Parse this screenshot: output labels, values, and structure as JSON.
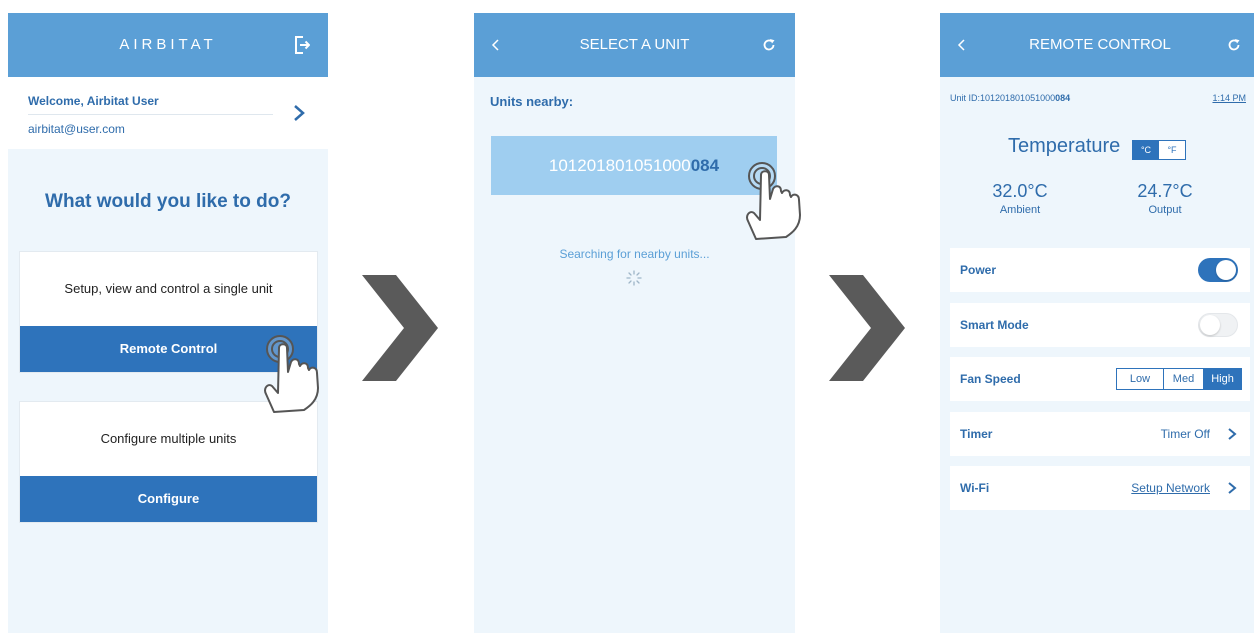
{
  "screen1": {
    "header_title": "AIRBITAT",
    "welcome": "Welcome, Airbitat User",
    "email": "airbitat@user.com",
    "question": "What would you like to do?",
    "card1_text": "Setup, view and control a single unit",
    "card1_button": "Remote Control",
    "card2_text": "Configure multiple units",
    "card2_button": "Configure"
  },
  "screen2": {
    "header_title": "SELECT A UNIT",
    "units_nearby": "Units nearby:",
    "unit_id_prefix": "101201801051000",
    "unit_id_suffix": "084",
    "searching": "Searching for nearby units..."
  },
  "screen3": {
    "header_title": "REMOTE CONTROL",
    "unit_id_label": "Unit ID:",
    "unit_id_prefix": "101201801051000",
    "unit_id_suffix": "084",
    "time": "1:14 PM",
    "temperature_title": "Temperature",
    "unit_celsius": "°C",
    "unit_fahrenheit": "°F",
    "ambient_value": "32.0°C",
    "ambient_label": "Ambient",
    "output_value": "24.7°C",
    "output_label": "Output",
    "power_label": "Power",
    "power_on": true,
    "smart_mode_label": "Smart Mode",
    "smart_mode_on": false,
    "fan_speed_label": "Fan Speed",
    "fan_options": [
      "Low",
      "Med",
      "High"
    ],
    "fan_selected": "High",
    "timer_label": "Timer",
    "timer_value": "Timer Off",
    "wifi_label": "Wi-Fi",
    "wifi_value": "Setup Network"
  },
  "colors": {
    "header": "#5b9fd6",
    "primary": "#2e73bb",
    "text_blue": "#2f6cab",
    "background": "#eef6fc",
    "unit_card": "#9fcef0",
    "arrow": "#5a5a5a"
  }
}
